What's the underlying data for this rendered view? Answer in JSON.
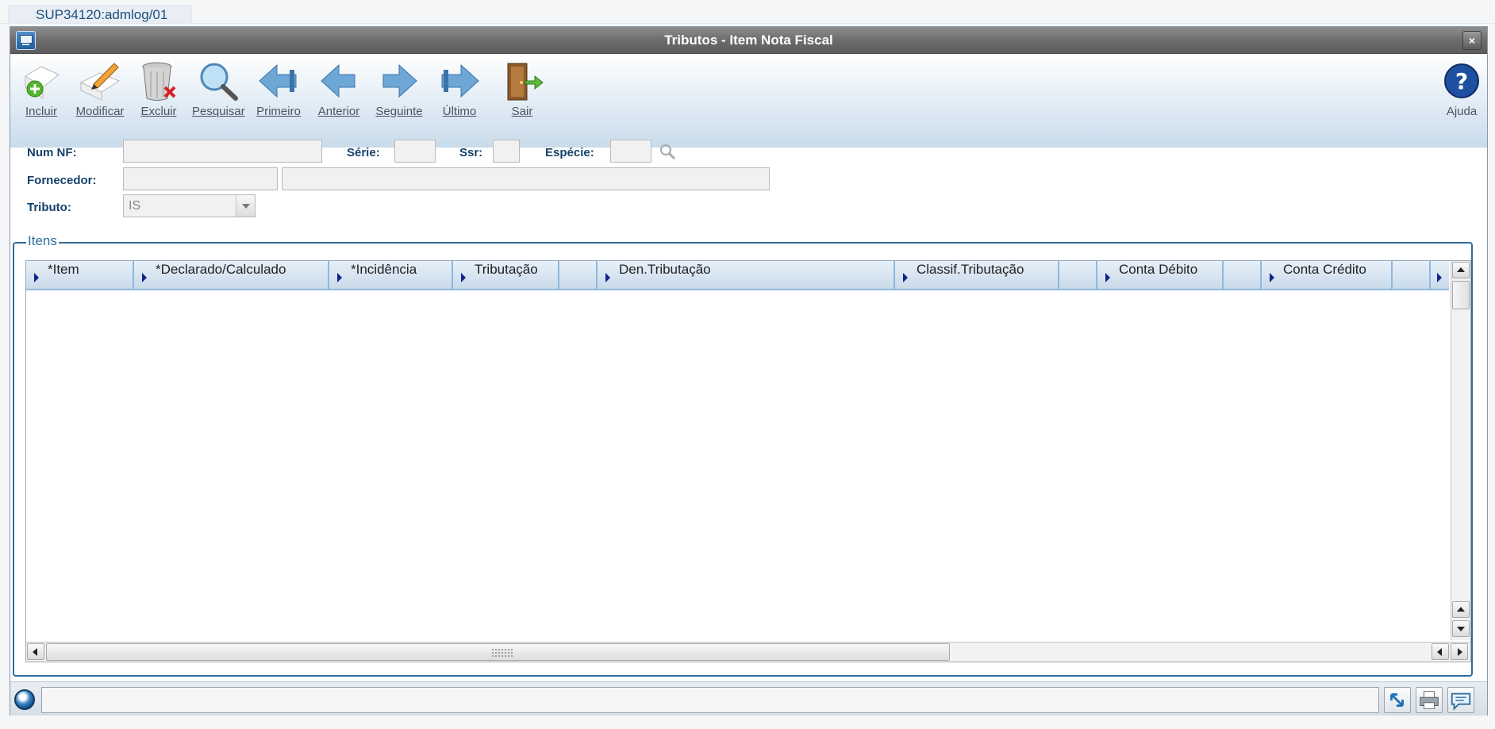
{
  "session": {
    "tab_label": "SUP34120:admlog/01"
  },
  "window": {
    "title": "Tributos - Item Nota Fiscal",
    "close_glyph": "×",
    "icon": "window-icon"
  },
  "toolbar": {
    "items": [
      {
        "label": "Incluir",
        "icon": "add-document-icon"
      },
      {
        "label": "Modificar",
        "icon": "edit-document-icon"
      },
      {
        "label": "Excluir",
        "icon": "trash-delete-icon"
      },
      {
        "label": "Pesquisar",
        "icon": "magnifier-icon"
      },
      {
        "label": "Primeiro",
        "icon": "first-arrow-icon"
      },
      {
        "label": "Anterior",
        "icon": "previous-arrow-icon"
      },
      {
        "label": "Seguinte",
        "icon": "next-arrow-icon"
      },
      {
        "label": "Último",
        "icon": "last-arrow-icon"
      },
      {
        "label": "Sair",
        "icon": "exit-door-icon"
      }
    ],
    "help_label": "Ajuda"
  },
  "form": {
    "num_nf_label": "Num NF:",
    "num_nf_value": "",
    "serie_label": "Série:",
    "serie_value": "",
    "ssr_label": "Ssr:",
    "ssr_value": "",
    "especie_label": "Espécie:",
    "especie_value": "",
    "fornecedor_label": "Fornecedor:",
    "fornecedor_code": "",
    "fornecedor_name": "",
    "tributo_label": "Tributo:",
    "tributo_value": "IS"
  },
  "items_section": {
    "legend": "Itens",
    "columns": [
      "*Item",
      "*Declarado/Calculado",
      "*Incidência",
      "Tributação",
      "",
      "Den.Tributação",
      "Classif.Tributação",
      "",
      "Conta Débito",
      "",
      "Conta Crédito",
      "",
      ""
    ],
    "rows": []
  },
  "status": {
    "message": ""
  },
  "colors": {
    "accent": "#15406a",
    "border": "#2f6e9d",
    "header_border": "#8fb7df",
    "title_bar": "#6a6a6a"
  }
}
